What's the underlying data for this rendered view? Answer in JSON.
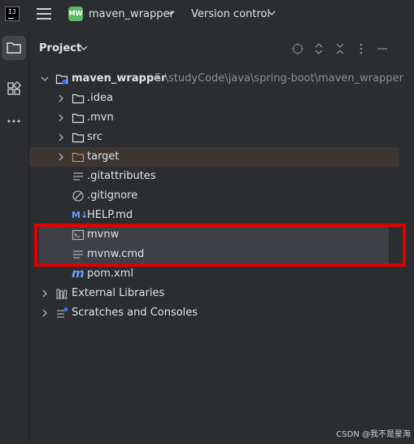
{
  "titlebar": {
    "project_badge": "MW",
    "project_name": "maven_wrapper",
    "version_control": "Version control"
  },
  "toolstrip": {
    "items": [
      "folder-icon",
      "structure-icon",
      "more-icon"
    ]
  },
  "panel": {
    "title": "Project"
  },
  "tree": {
    "root": {
      "label": "maven_wrapper",
      "path": "E:\\studyCode\\java\\spring-boot\\maven_wrapper"
    },
    "idea": ".idea",
    "mvn": ".mvn",
    "src": "src",
    "target": "target",
    "gitattributes": ".gitattributes",
    "gitignore": ".gitignore",
    "help": "HELP.md",
    "mvnw": "mvnw",
    "mvnwcmd": "mvnw.cmd",
    "pom": "pom.xml",
    "extlibs": "External Libraries",
    "scratches": "Scratches and Consoles"
  },
  "icons": {
    "md_badge": "M↓",
    "pom_glyph": "m"
  },
  "watermark": "CSDN @我不是星海",
  "colors": {
    "background": "#2b2d30",
    "selection": "#3b3631",
    "highlight_box": "#e00000",
    "folder_excluded": "#d38a6a"
  }
}
